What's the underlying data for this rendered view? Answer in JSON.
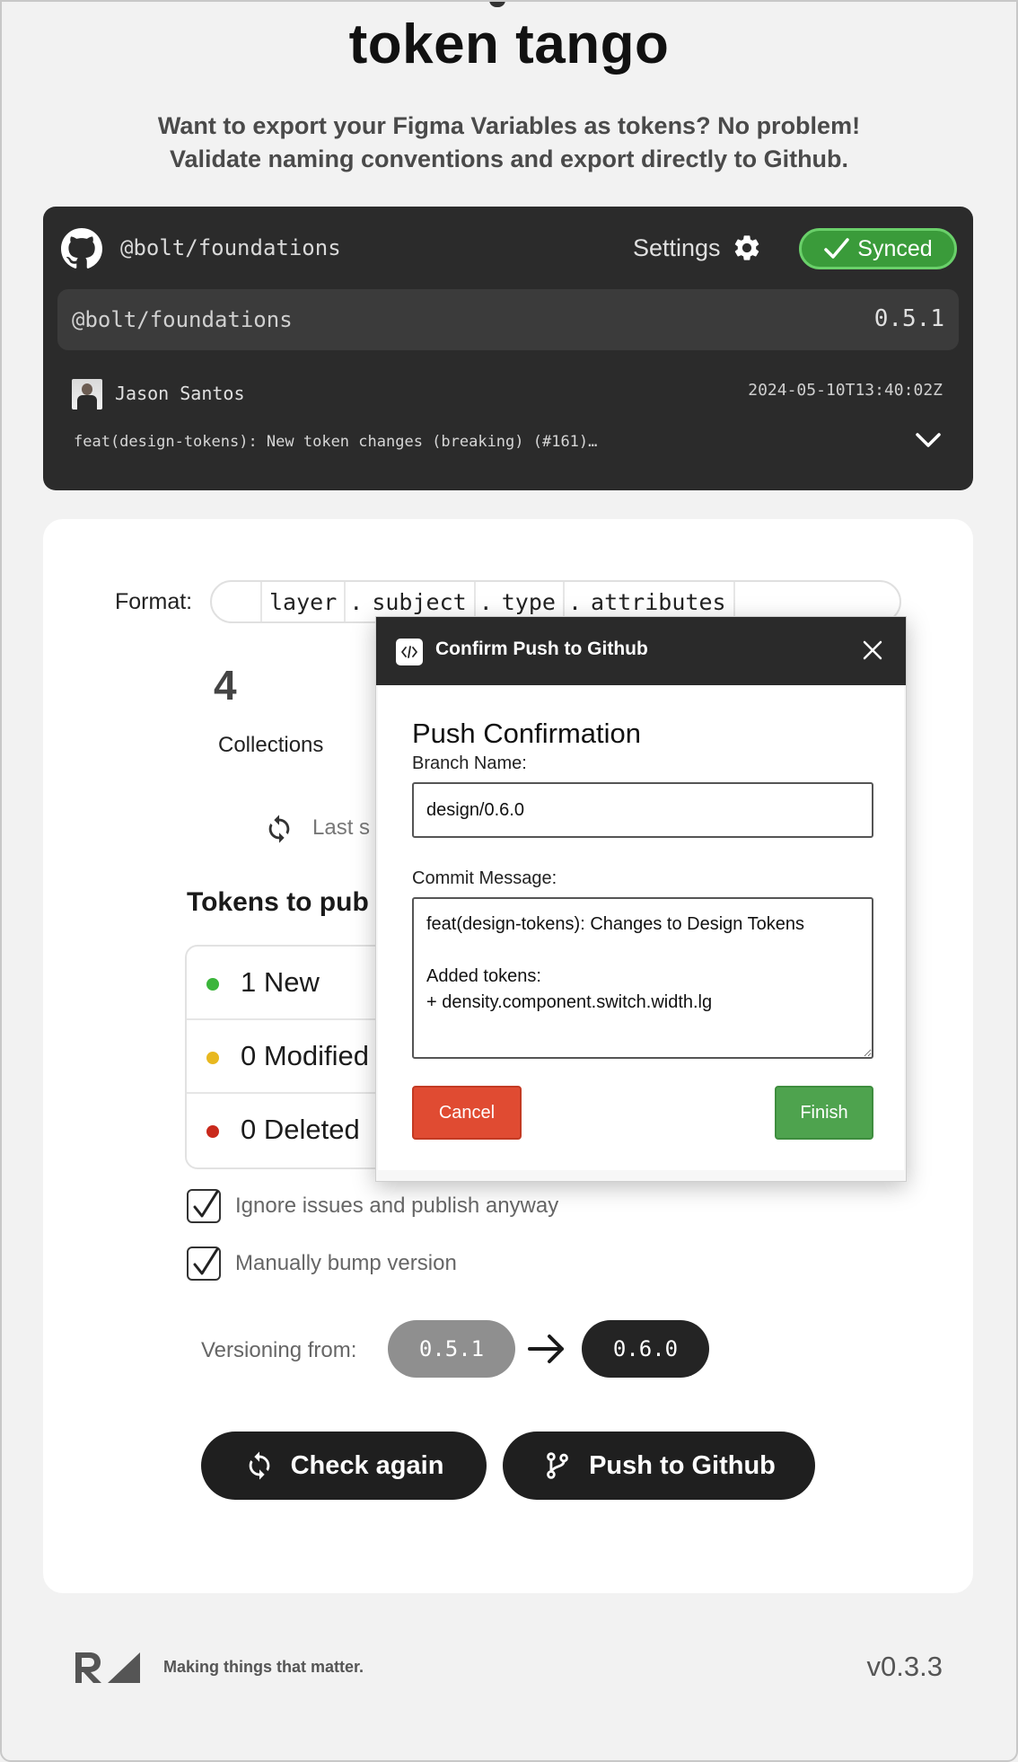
{
  "header": {
    "title": "token tango",
    "tagline_line1": "Want to export your Figma Variables as tokens? No problem!",
    "tagline_line2": "Validate naming conventions and export directly to Github."
  },
  "repo": {
    "name": "@bolt/foundations",
    "settings_label": "Settings",
    "status": "Synced",
    "package_name": "@bolt/foundations",
    "version": "0.5.1",
    "author": "Jason Santos",
    "timestamp": "2024-05-10T13:40:02Z",
    "commit_message": "feat(design-tokens): New token changes (breaking) (#161)…"
  },
  "format": {
    "label": "Format:",
    "segments": [
      "layer",
      "subject",
      "type",
      "attributes"
    ],
    "separator": "."
  },
  "stats": {
    "collections_count": "4",
    "collections_label": "Collections",
    "last_synced_partial": "Last s"
  },
  "tokens": {
    "title_partial": "Tokens to pub",
    "rows": [
      {
        "label": "1 New",
        "color": "#3bb53b"
      },
      {
        "label": "0 Modified",
        "color": "#e8b820"
      },
      {
        "label": "0 Deleted",
        "color": "#c9291c"
      }
    ]
  },
  "options": {
    "ignore_issues": "Ignore issues and publish anyway",
    "manual_bump": "Manually bump version"
  },
  "versioning": {
    "label": "Versioning from:",
    "from": "0.5.1",
    "to": "0.6.0"
  },
  "actions": {
    "check_again": "Check again",
    "push": "Push to Github"
  },
  "modal": {
    "window_title": "Confirm Push to Github",
    "heading": "Push Confirmation",
    "branch_label": "Branch Name:",
    "branch_value": "design/0.6.0",
    "commit_label": "Commit Message:",
    "commit_value": "feat(design-tokens): Changes to Design Tokens\n\nAdded tokens:\n+ density.component.switch.width.lg",
    "cancel_label": "Cancel",
    "finish_label": "Finish"
  },
  "footer": {
    "tagline": "Making things that matter.",
    "version": "v0.3.3"
  }
}
